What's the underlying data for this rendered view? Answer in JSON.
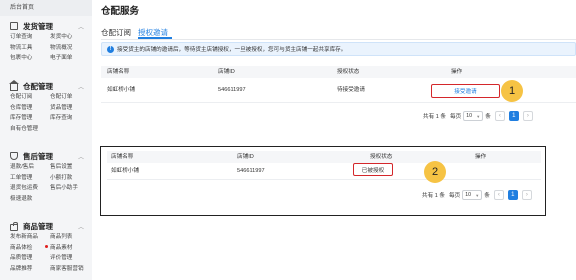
{
  "sidebar": {
    "top_label": "后台首页",
    "groups": [
      {
        "title": "发货管理",
        "icon": "document-icon",
        "items": [
          "订单查询",
          "发货中心",
          "物流工具",
          "物流概况",
          "包裹中心",
          "电子面单"
        ]
      },
      {
        "title": "仓配管理",
        "icon": "warehouse-icon",
        "items": [
          "仓配订阅",
          "仓配订单",
          "仓库管理",
          "货品管理",
          "库存管理",
          "库存查询",
          "自有仓管理"
        ]
      },
      {
        "title": "售后管理",
        "icon": "shield-icon",
        "items": [
          "退款/售后",
          "售后设置",
          "工单管理",
          "小额打款",
          "退货包运费",
          "售后小助手",
          "极速退款"
        ]
      },
      {
        "title": "商品管理",
        "icon": "bag-icon",
        "items": [
          "发布新商品",
          "商品列表",
          "商品体检",
          "商品素材",
          "品质管理",
          "评价管理",
          "品牌推荐",
          "商家客服营销"
        ]
      }
    ]
  },
  "page": {
    "title": "仓配服务",
    "tabs": [
      "仓配订阅",
      "授权邀请"
    ],
    "active_tab": "授权邀请",
    "notice": "接受货主的店铺的邀请后，等待货主店铺授权，一旦被授权，您可与货主店铺一起共享库存。"
  },
  "table1": {
    "headers": [
      "店铺名称",
      "店铺ID",
      "授权状态",
      "操作"
    ],
    "row": {
      "store_name": "如虹桥小铺",
      "store_id": "546611997",
      "status": "待接受邀请",
      "action": "接受邀请"
    }
  },
  "table2": {
    "headers": [
      "店铺名称",
      "店铺ID",
      "授权状态",
      "操作"
    ],
    "row": {
      "store_name": "如虹桥小铺",
      "store_id": "546611997",
      "status": "已被授权",
      "action": ""
    }
  },
  "pagination": {
    "total": "共有 1 条",
    "per_page_label": "每页",
    "page_size": "10",
    "unit": "条",
    "current_page": "1",
    "prev": "‹",
    "next": "›"
  },
  "annotations": {
    "badge1": "1",
    "badge2": "2"
  },
  "colors": {
    "accent": "#1f7ee0",
    "highlight_border": "#d4272b",
    "badge": "#f6c344"
  }
}
